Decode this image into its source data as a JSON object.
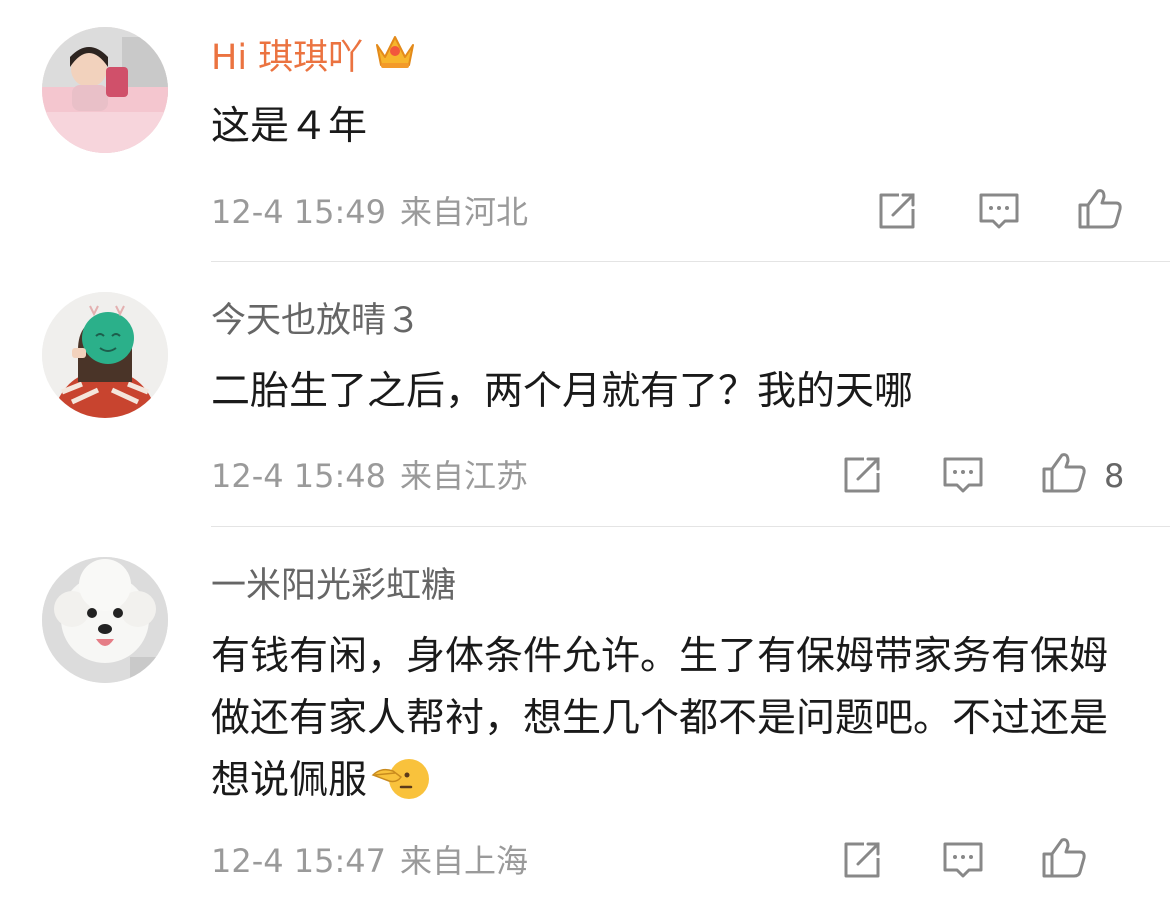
{
  "comments": [
    {
      "username": "Hi 琪琪吖",
      "text": "这是４年",
      "time": "12-4 15:49",
      "location": "来自河北",
      "likes": "",
      "vip": true
    },
    {
      "username": "今天也放晴３",
      "text": "二胎生了之后，两个月就有了？我的天哪",
      "time": "12-4 15:48",
      "location": "来自江苏",
      "likes": "8",
      "vip": false
    },
    {
      "username": "一米阳光彩虹糖",
      "text": "有钱有闲，身体条件允许。生了有保姆带家务有保姆做还有家人帮衬，想生几个都不是问题吧。不过还是想说佩服",
      "time": "12-4 15:47",
      "location": "来自上海",
      "likes": "",
      "vip": false
    }
  ],
  "icons": {
    "share": "share-icon",
    "comment": "comment-icon",
    "like": "thumbs-up-icon",
    "vip": "crown-icon",
    "emoji": "point-emoji-icon"
  },
  "colors": {
    "vip_name": "#eb7340",
    "name": "#666666",
    "meta": "#9a9a9a",
    "text": "#1a1a1a"
  }
}
